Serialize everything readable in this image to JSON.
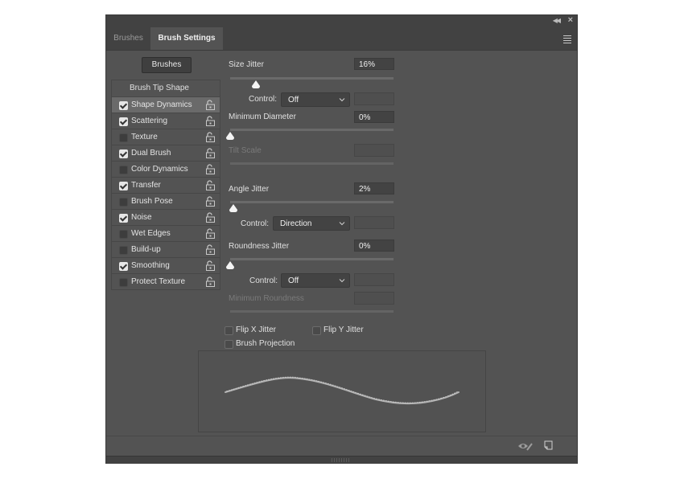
{
  "window": {
    "collapse_icon": "double-chevron-left-icon",
    "close_icon": "close-icon",
    "menu_icon": "hamburger-menu-icon"
  },
  "tabs": [
    {
      "label": "Brushes",
      "active": false
    },
    {
      "label": "Brush Settings",
      "active": true
    }
  ],
  "brushes_button": "Brushes",
  "options_header": "Brush Tip Shape",
  "options": [
    {
      "label": "Shape Dynamics",
      "checked": true,
      "selected": true
    },
    {
      "label": "Scattering",
      "checked": true
    },
    {
      "label": "Texture",
      "checked": false
    },
    {
      "label": "Dual Brush",
      "checked": true
    },
    {
      "label": "Color Dynamics",
      "checked": false
    },
    {
      "label": "Transfer",
      "checked": true
    },
    {
      "label": "Brush Pose",
      "checked": false
    },
    {
      "label": "Noise",
      "checked": true
    },
    {
      "label": "Wet Edges",
      "checked": false
    },
    {
      "label": "Build-up",
      "checked": false
    },
    {
      "label": "Smoothing",
      "checked": true
    },
    {
      "label": "Protect Texture",
      "checked": false
    }
  ],
  "settings": {
    "size_jitter": {
      "label": "Size Jitter",
      "value": "16%",
      "slider_fraction": 0.16
    },
    "size_control": {
      "label": "Control:",
      "value": "Off"
    },
    "minimum_diameter": {
      "label": "Minimum Diameter",
      "value": "0%",
      "slider_fraction": 0.0
    },
    "tilt_scale": {
      "label": "Tilt Scale",
      "value": "",
      "disabled": true
    },
    "angle_jitter": {
      "label": "Angle Jitter",
      "value": "2%",
      "slider_fraction": 0.02
    },
    "angle_control": {
      "label": "Control:",
      "value": "Direction"
    },
    "roundness_jitter": {
      "label": "Roundness Jitter",
      "value": "0%",
      "slider_fraction": 0.0
    },
    "roundness_control": {
      "label": "Control:",
      "value": "Off"
    },
    "minimum_roundness": {
      "label": "Minimum Roundness",
      "value": "",
      "disabled": true
    }
  },
  "checkboxes": {
    "flip_x": {
      "label": "Flip X Jitter",
      "checked": false
    },
    "flip_y": {
      "label": "Flip Y Jitter",
      "checked": false
    },
    "brush_projection": {
      "label": "Brush Projection",
      "checked": false
    }
  },
  "bottom_icons": [
    "eye-toggle-icon",
    "create-new-brush-icon"
  ]
}
